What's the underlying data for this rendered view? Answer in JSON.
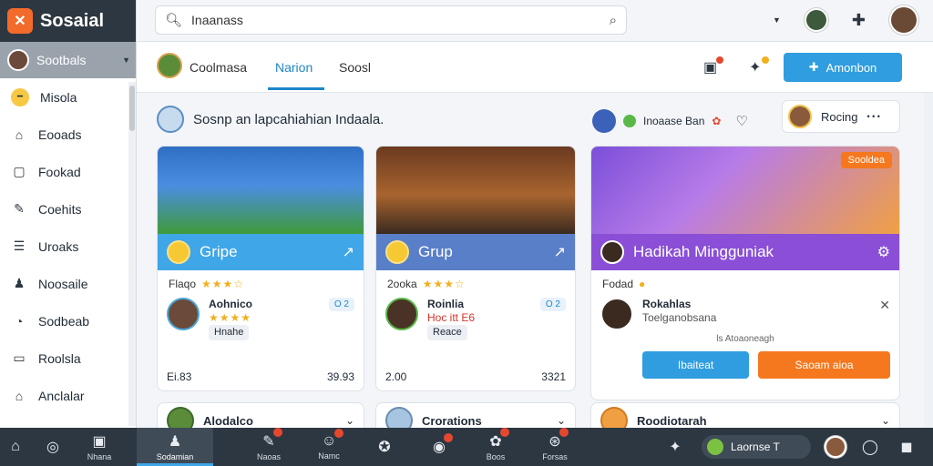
{
  "brand": {
    "name": "Sosaial",
    "logo": "x-logo-icon",
    "color": "#f26b2a"
  },
  "sidebar": {
    "active": {
      "label": "Sootbals"
    },
    "items": [
      {
        "label": "Misola",
        "icon": "emoji-face-icon"
      },
      {
        "label": "Eooads",
        "icon": "bag-icon"
      },
      {
        "label": "Fookad",
        "icon": "box-icon"
      },
      {
        "label": "Coehits",
        "icon": "edit-icon"
      },
      {
        "label": "Uroaks",
        "icon": "list-icon"
      },
      {
        "label": "Noosaile",
        "icon": "person-icon"
      },
      {
        "label": "Sodbeab",
        "icon": "chat-icon"
      },
      {
        "label": "Roolsla",
        "icon": "card-icon"
      },
      {
        "label": "Anclalar",
        "icon": "home-icon"
      }
    ]
  },
  "search": {
    "value": "Inaanass"
  },
  "subhead": {
    "tabs": [
      {
        "label": "Coolmasa"
      },
      {
        "label": "Narion"
      },
      {
        "label": "Soosl"
      }
    ],
    "action_label": "Amonbon",
    "accent": "#2f9de0"
  },
  "main": {
    "prompt": "Sosnp an lapcahiahian Indaala.",
    "filter_label": "Inoaase Ban",
    "user_pill": {
      "name": "Rocing",
      "dots": "• • •"
    }
  },
  "cards": [
    {
      "band_title": "Gripe",
      "band_color": "#3fa6e8",
      "meta_label": "Flaqo",
      "stars": "★★★☆",
      "person_name": "Aohnico",
      "person_stars": "★★★★",
      "chip": "Hnahe",
      "badge": "O 2",
      "foot_left": "Ei.83",
      "foot_right": "39.93",
      "bottom_title": "Alodalco"
    },
    {
      "band_title": "Grup",
      "band_color": "#5a7fc9",
      "meta_label": "2ooka",
      "stars": "★★★☆",
      "person_name": "Roinlia",
      "person_sub": "Hoc itt E6",
      "chip": "Reace",
      "badge": "O 2",
      "foot_left": "2.00",
      "foot_right": "3321",
      "bottom_title": "Crorations"
    },
    {
      "band_title": "Hadikah Mingguniak",
      "band_color": "#8a4fd6",
      "tag": "Sooldea",
      "meta_label": "Fodad",
      "person_name": "Rokahlas",
      "person_sub": "Toelganobsana",
      "caption": "ls Atoaoneagh",
      "btn_blue": "Ibaiteat",
      "btn_orange": "Saoam aioa",
      "bottom_title": "Roodiotarah"
    }
  ],
  "bottombar": {
    "items": [
      {
        "label": "",
        "icon": "home-icon"
      },
      {
        "label": "",
        "icon": "search-icon"
      },
      {
        "label": "Nhana",
        "icon": "inbox-icon"
      },
      {
        "label": "Sodamian",
        "icon": "user-icon"
      },
      {
        "label": "Naoas",
        "icon": "chat-icon"
      },
      {
        "label": "Namc",
        "icon": "people-icon"
      },
      {
        "label": "",
        "icon": "globe-icon"
      },
      {
        "label": "",
        "icon": "message-icon"
      },
      {
        "label": "Boos",
        "icon": "leaf-icon"
      },
      {
        "label": "Forsas",
        "icon": "compass-icon"
      }
    ],
    "pill_label": "Laornse T"
  }
}
